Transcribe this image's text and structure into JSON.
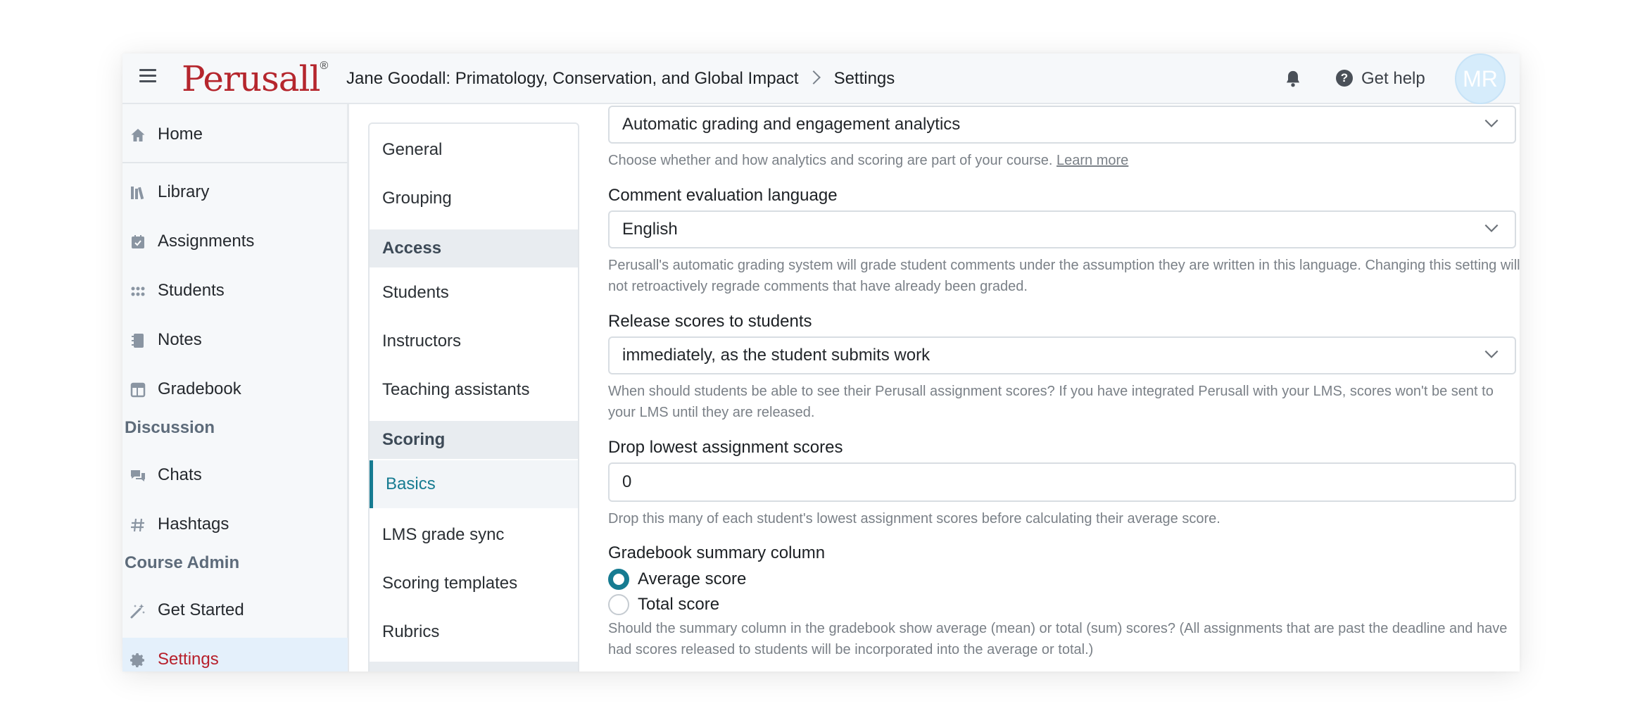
{
  "header": {
    "logo_text": "Perusall",
    "logo_mark": "®",
    "breadcrumb_course": "Jane Goodall: Primatology, Conservation, and Global Impact",
    "breadcrumb_page": "Settings",
    "help_label": "Get help",
    "avatar_initials": "MR"
  },
  "sidebar": {
    "home": "Home",
    "library": "Library",
    "assignments": "Assignments",
    "students": "Students",
    "notes": "Notes",
    "gradebook": "Gradebook",
    "section_discussion": "Discussion",
    "chats": "Chats",
    "hashtags": "Hashtags",
    "section_course_admin": "Course Admin",
    "get_started": "Get Started",
    "settings": "Settings"
  },
  "settings_menu": {
    "general": "General",
    "grouping": "Grouping",
    "access_header": "Access",
    "students": "Students",
    "instructors": "Instructors",
    "teaching_assistants": "Teaching assistants",
    "scoring_header": "Scoring",
    "basics": "Basics",
    "lms_grade_sync": "LMS grade sync",
    "scoring_templates": "Scoring templates",
    "rubrics": "Rubrics"
  },
  "content": {
    "analytics_select_value": "Automatic grading and engagement analytics",
    "analytics_help": "Choose whether and how analytics and scoring are part of your course.",
    "analytics_learn_more": "Learn more",
    "language_label": "Comment evaluation language",
    "language_value": "English",
    "language_help": "Perusall's automatic grading system will grade student comments under the assumption they are written in this language. Changing this setting will not retroactively regrade comments that have already been graded.",
    "release_label": "Release scores to students",
    "release_value": "immediately, as the student submits work",
    "release_help": "When should students be able to see their Perusall assignment scores? If you have integrated Perusall with your LMS, scores won't be sent to your LMS until they are released.",
    "drop_label": "Drop lowest assignment scores",
    "drop_value": "0",
    "drop_help": "Drop this many of each student's lowest assignment scores before calculating their average score.",
    "summary_label": "Gradebook summary column",
    "summary_option_average": "Average score",
    "summary_option_total": "Total score",
    "summary_selected": "Average score",
    "summary_help": "Should the summary column in the gradebook show average (mean) or total (sum) scores? (All assignments that are past the deadline and have had scores released to students will be incorporated into the average or total.)"
  },
  "colors": {
    "brand_red": "#b5262d",
    "accent_teal": "#167b91",
    "active_nav_bg": "#e4f0fb"
  }
}
